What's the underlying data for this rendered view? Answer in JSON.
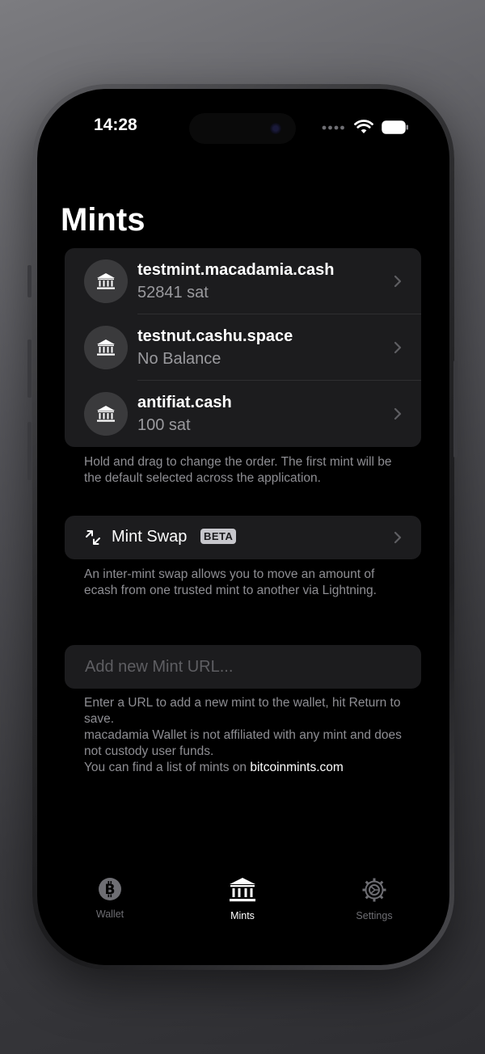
{
  "status": {
    "time": "14:28"
  },
  "header": {
    "title": "Mints"
  },
  "mints": [
    {
      "name": "testmint.macadamia.cash",
      "balance": "52841 sat"
    },
    {
      "name": "testnut.cashu.space",
      "balance": "No Balance"
    },
    {
      "name": "antifiat.cash",
      "balance": "100 sat"
    }
  ],
  "mints_footnote": "Hold and drag to change the order. The first mint will be the default selected across the application.",
  "swap": {
    "label": "Mint Swap",
    "badge": "BETA",
    "footnote": "An inter-mint swap allows you to move an amount of ecash from one trusted mint to another via Lightning."
  },
  "add_mint": {
    "placeholder": "Add new Mint URL...",
    "footnote_line1": "Enter a URL to add a new mint to the wallet, hit Return to save.",
    "footnote_line2": "macadamia Wallet is not affiliated with any mint and does not custody user funds.",
    "footnote_line3_prefix": "You can find a list of mints on ",
    "footnote_link": "bitcoinmints.com"
  },
  "tabs": [
    {
      "label": "Wallet",
      "icon": "bitcoin-icon",
      "active": false
    },
    {
      "label": "Mints",
      "icon": "bank-icon",
      "active": true
    },
    {
      "label": "Settings",
      "icon": "gear-icon",
      "active": false
    }
  ],
  "colors": {
    "background": "#000000",
    "card": "#1c1c1e",
    "secondary_text": "#8e8e93",
    "inactive_tab": "#6e6e73"
  }
}
